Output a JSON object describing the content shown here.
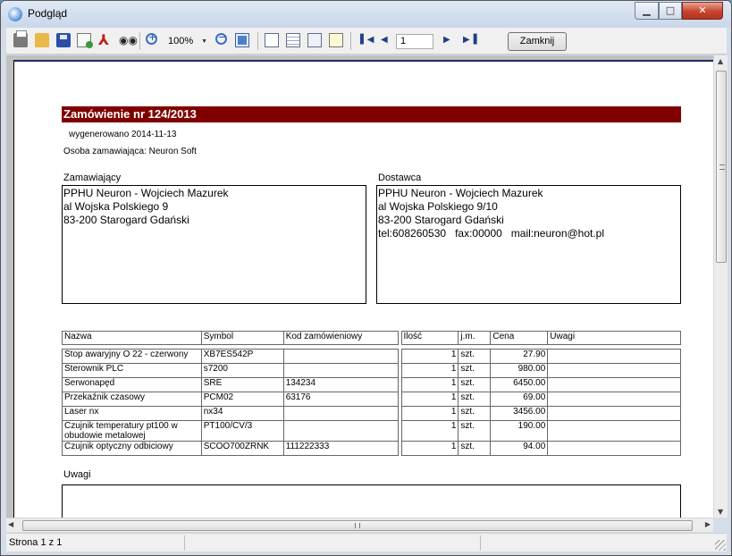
{
  "window": {
    "title": "Podgląd"
  },
  "toolbar": {
    "zoom": "100%",
    "page": "1",
    "close_label": "Zamknij"
  },
  "status": {
    "page_info": "Strona 1 z 1"
  },
  "document": {
    "title": "Zamówienie nr 124/2013",
    "generated": "wygenerowano 2014-11-13",
    "person": "Osoba zamawiająca: Neuron Soft",
    "ordering_label": "Zamawiający",
    "ordering_lines": [
      "PPHU Neuron - Wojciech Mazurek",
      "al Wojska Polskiego 9",
      "83-200 Starogard Gdański"
    ],
    "supplier_label": "Dostawca",
    "supplier_lines": [
      "PPHU Neuron - Wojciech Mazurek",
      "al Wojska Polskiego 9/10",
      "83-200 Starogard Gdański",
      "tel:608260530   fax:00000   mail:neuron@hot.pl"
    ],
    "headers": {
      "name": "Nazwa",
      "symbol": "Symbol",
      "code": "Kod zamówieniowy",
      "qty": "Ilość",
      "unit": "j.m.",
      "price": "Cena",
      "notes": "Uwagi"
    },
    "rows": [
      {
        "name": "Stop awaryjny O 22 - czerwony",
        "symbol": "XB7ES542P",
        "code": "",
        "qty": "1",
        "unit": "szt.",
        "price": "27.90",
        "notes": ""
      },
      {
        "name": "Sterownik PLC",
        "symbol": "s7200",
        "code": "",
        "qty": "1",
        "unit": "szt.",
        "price": "980.00",
        "notes": ""
      },
      {
        "name": "Serwonapęd",
        "symbol": "SRE",
        "code": "134234",
        "qty": "1",
        "unit": "szt.",
        "price": "6450.00",
        "notes": ""
      },
      {
        "name": "Przekaźnik czasowy",
        "symbol": "PCM02",
        "code": "63176",
        "qty": "1",
        "unit": "szt.",
        "price": "69.00",
        "notes": ""
      },
      {
        "name": "Laser nx",
        "symbol": "nx34",
        "code": "",
        "qty": "1",
        "unit": "szt.",
        "price": "3456.00",
        "notes": ""
      },
      {
        "name": "Czujnik temperatury pt100 w obudowie metalowej",
        "symbol": "PT100/CV/3",
        "code": "",
        "qty": "1",
        "unit": "szt.",
        "price": "190.00",
        "notes": ""
      },
      {
        "name": "Czujnik optyczny odbiciowy",
        "symbol": "SCOO700ZRNK",
        "code": "111222333",
        "qty": "1",
        "unit": "szt.",
        "price": "94.00",
        "notes": ""
      }
    ],
    "notes_label": "Uwagi"
  }
}
